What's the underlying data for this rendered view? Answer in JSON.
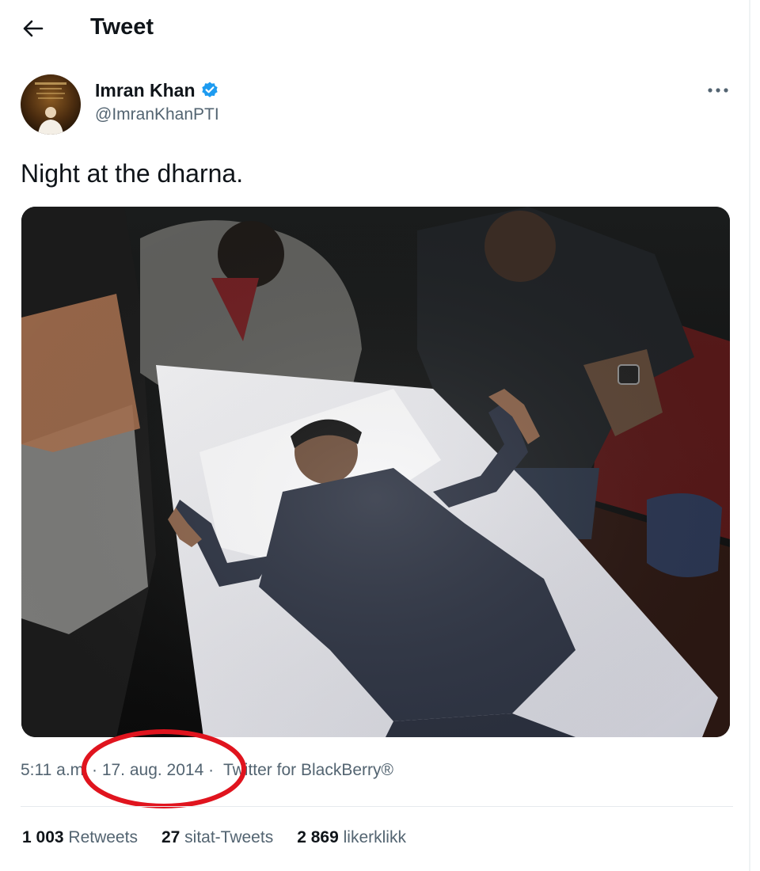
{
  "header": {
    "title": "Tweet",
    "back_icon": "arrow-left-icon"
  },
  "author": {
    "name": "Imran Khan",
    "handle": "@ImranKhanPTI",
    "verified_icon": "verified-badge-icon",
    "verified_color": "#1d9bf0"
  },
  "more_icon": "more-horizontal-icon",
  "tweet": {
    "text": "Night at the dharna."
  },
  "meta": {
    "time": "5:11 a.m",
    "date": "· 17. aug. 2014 ·",
    "source": "Twitter for BlackBerry®",
    "highlight_color": "#e0141e"
  },
  "stats": {
    "retweets_count": "1 003",
    "retweets_label": "Retweets",
    "quotes_count": "27",
    "quotes_label": "sitat-Tweets",
    "likes_count": "2 869",
    "likes_label": "likerklikk"
  }
}
